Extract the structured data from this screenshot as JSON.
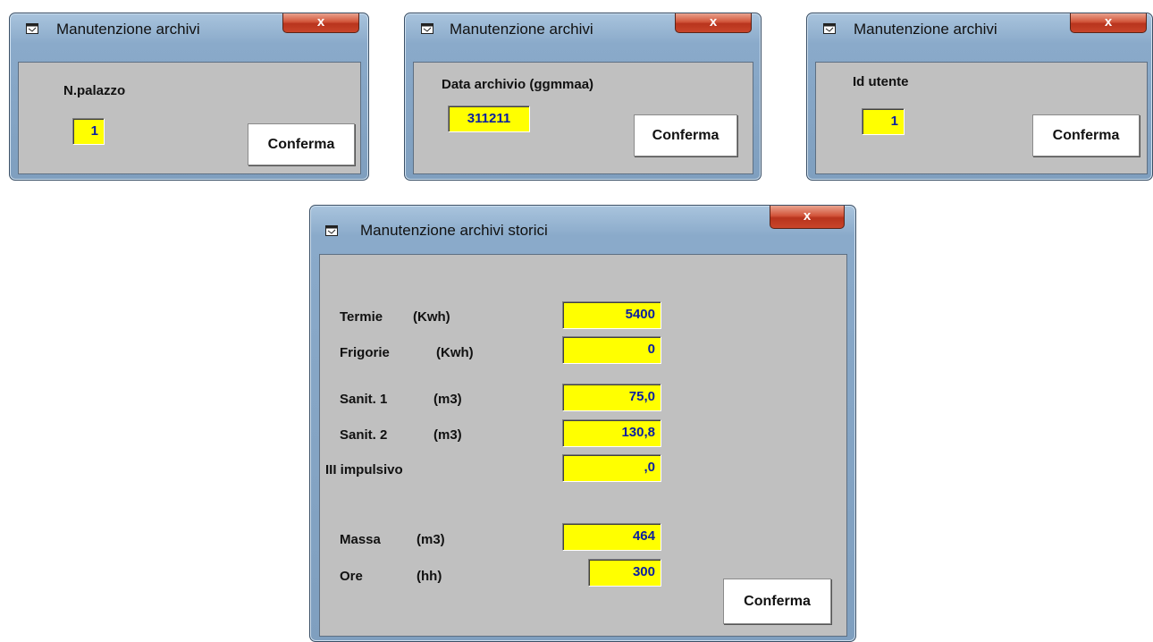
{
  "windows": [
    {
      "title": "Manutenzione archivi",
      "close_label": "x",
      "field_label": "N.palazzo",
      "field_value": "1",
      "confirm_label": "Conferma"
    },
    {
      "title": "Manutenzione archivi",
      "close_label": "x",
      "field_label": "Data archivio (ggmmaa)",
      "field_value": "311211",
      "confirm_label": "Conferma"
    },
    {
      "title": "Manutenzione archivi",
      "close_label": "x",
      "field_label": "Id utente",
      "field_value": "1",
      "confirm_label": "Conferma"
    }
  ],
  "storici": {
    "title": "Manutenzione archivi storici",
    "close_label": "x",
    "rows": [
      {
        "name": "Termie",
        "unit": "(Kwh)",
        "value": "5400"
      },
      {
        "name": "Frigorie",
        "unit": "(Kwh)",
        "value": "0"
      },
      {
        "name": "Sanit. 1",
        "unit": "(m3)",
        "value": "75,0"
      },
      {
        "name": "Sanit. 2",
        "unit": "(m3)",
        "value": "130,8"
      },
      {
        "name": "III impulsivo",
        "unit": "",
        "value": ",0"
      },
      {
        "name": "Massa",
        "unit": "(m3)",
        "value": "464"
      },
      {
        "name": "Ore",
        "unit": "(hh)",
        "value": "300"
      }
    ],
    "confirm_label": "Conferma"
  },
  "colors": {
    "field_bg": "#ffff00",
    "field_text": "#0a1fa0",
    "client_bg": "#c0c0c0",
    "close_button": "#c9452a"
  },
  "icons": [
    "window-icon",
    "close-icon"
  ]
}
